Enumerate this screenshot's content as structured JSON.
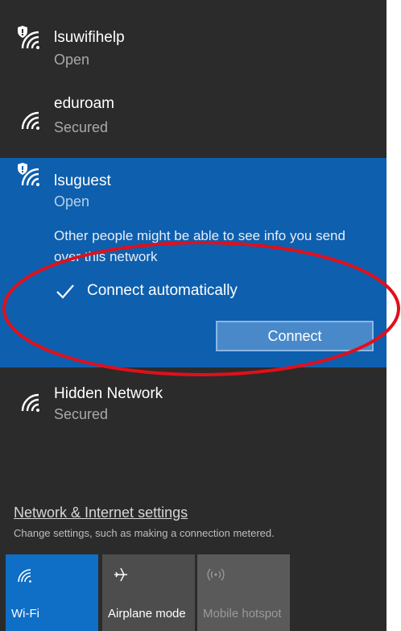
{
  "networks": [
    {
      "name": "lsuwifihelp",
      "status": "Open",
      "shield": true
    },
    {
      "name": "eduroam",
      "status": "Secured",
      "shield": false
    },
    {
      "name": "lsuguest",
      "status": "Open",
      "shield": true
    },
    {
      "name": "Hidden Network",
      "status": "Secured",
      "shield": false
    }
  ],
  "selected": {
    "warning": "Other people might be able to see info you send over this network",
    "auto_label": "Connect automatically",
    "auto_checked": true,
    "connect_label": "Connect"
  },
  "footer": {
    "settings_link": "Network & Internet settings",
    "settings_desc": "Change settings, such as making a connection metered."
  },
  "quick_actions": [
    {
      "label": "Wi-Fi",
      "icon": "wifi-icon",
      "state": "on"
    },
    {
      "label": "Airplane mode",
      "icon": "airplane-icon",
      "state": "off"
    },
    {
      "label": "Mobile hotspot",
      "icon": "hotspot-icon",
      "state": "disabled"
    }
  ],
  "colors": {
    "panel_bg": "#2b2b2b",
    "selected_bg": "#0e5fae",
    "accent": "#0f6ec6",
    "annotation": "#e0101a"
  }
}
